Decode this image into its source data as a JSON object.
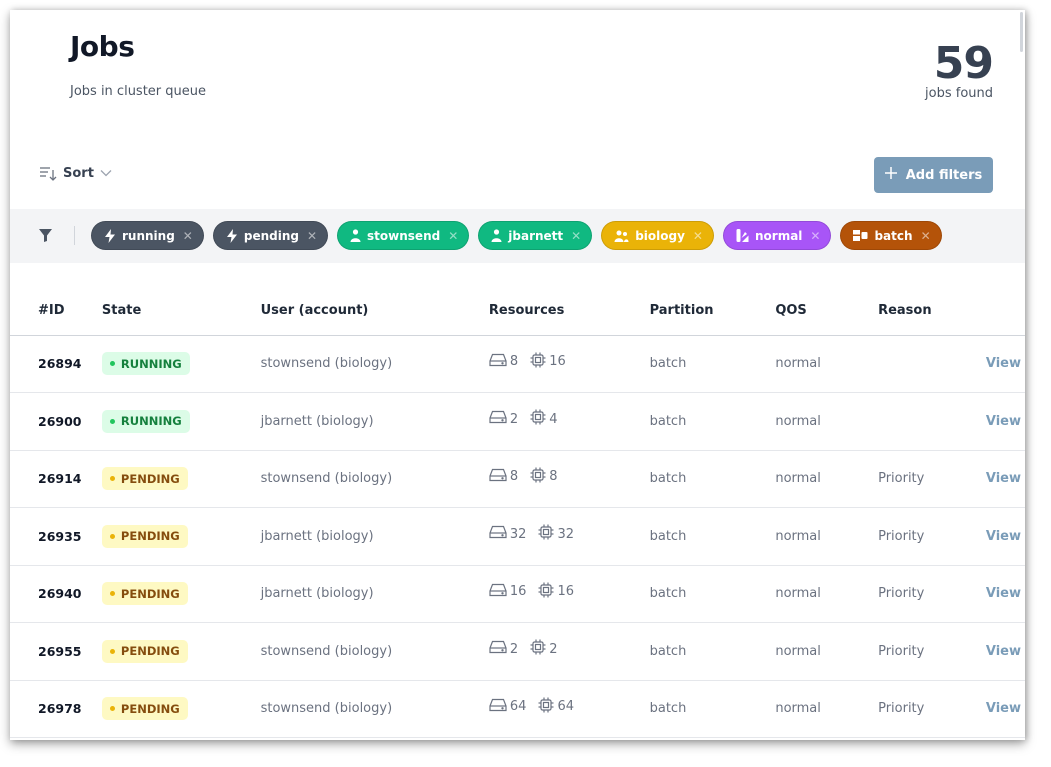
{
  "header": {
    "title": "Jobs",
    "subtitle": "Jobs in cluster queue",
    "count": "59",
    "count_label": "jobs found"
  },
  "toolbar": {
    "sort_label": "Sort",
    "add_filters_label": "Add filters"
  },
  "filters": [
    {
      "label": "running",
      "icon": "bolt-icon",
      "color": "#4b5563"
    },
    {
      "label": "pending",
      "icon": "bolt-icon",
      "color": "#4b5563"
    },
    {
      "label": "stownsend",
      "icon": "user-icon",
      "color": "#10b981"
    },
    {
      "label": "jbarnett",
      "icon": "user-icon",
      "color": "#10b981"
    },
    {
      "label": "biology",
      "icon": "users-icon",
      "color": "#eab308"
    },
    {
      "label": "normal",
      "icon": "swatch-icon",
      "color": "#a855f7"
    },
    {
      "label": "batch",
      "icon": "partition-icon",
      "color": "#b45309"
    }
  ],
  "table": {
    "columns": [
      "#ID",
      "State",
      "User (account)",
      "Resources",
      "Partition",
      "QOS",
      "Reason",
      ""
    ],
    "rows": [
      {
        "id": "26894",
        "state": "RUNNING",
        "user": "stownsend (biology)",
        "nodes": "8",
        "cpus": "16",
        "partition": "batch",
        "qos": "normal",
        "reason": "",
        "action": "View"
      },
      {
        "id": "26900",
        "state": "RUNNING",
        "user": "jbarnett (biology)",
        "nodes": "2",
        "cpus": "4",
        "partition": "batch",
        "qos": "normal",
        "reason": "",
        "action": "View"
      },
      {
        "id": "26914",
        "state": "PENDING",
        "user": "stownsend (biology)",
        "nodes": "8",
        "cpus": "8",
        "partition": "batch",
        "qos": "normal",
        "reason": "Priority",
        "action": "View"
      },
      {
        "id": "26935",
        "state": "PENDING",
        "user": "jbarnett (biology)",
        "nodes": "32",
        "cpus": "32",
        "partition": "batch",
        "qos": "normal",
        "reason": "Priority",
        "action": "View"
      },
      {
        "id": "26940",
        "state": "PENDING",
        "user": "jbarnett (biology)",
        "nodes": "16",
        "cpus": "16",
        "partition": "batch",
        "qos": "normal",
        "reason": "Priority",
        "action": "View"
      },
      {
        "id": "26955",
        "state": "PENDING",
        "user": "stownsend (biology)",
        "nodes": "2",
        "cpus": "2",
        "partition": "batch",
        "qos": "normal",
        "reason": "Priority",
        "action": "View"
      },
      {
        "id": "26978",
        "state": "PENDING",
        "user": "stownsend (biology)",
        "nodes": "64",
        "cpus": "64",
        "partition": "batch",
        "qos": "normal",
        "reason": "Priority",
        "action": "View"
      }
    ]
  }
}
